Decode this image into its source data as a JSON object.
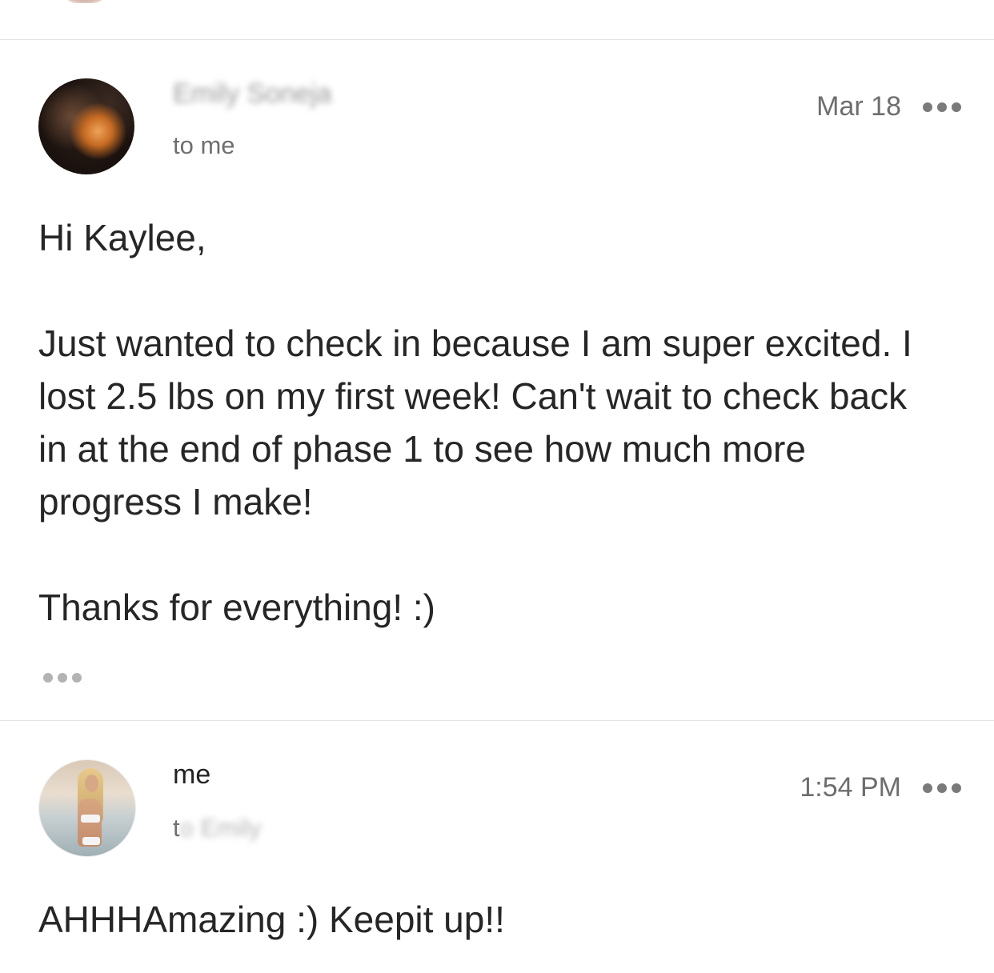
{
  "messages": [
    {
      "sender": "Emily Soneja",
      "recipient": "to me",
      "date": "Mar 18",
      "avatar_icon": "avatar-photo-icon",
      "body": {
        "greeting": "Hi Kaylee,",
        "paragraph": "Just wanted to check in because I am super excited. I lost 2.5 lbs on my first week! Can't wait to check back in at the end of phase 1 to see how much more progress I make!",
        "closing": "Thanks for everything! :)"
      },
      "more_icon": "more-options-icon",
      "quoted_icon": "show-trimmed-content-icon"
    },
    {
      "sender": "me",
      "recipient_first": "t",
      "recipient_rest": "o Emily",
      "date": "1:54 PM",
      "avatar_icon": "avatar-photo-icon",
      "body": {
        "text": "AHHHAmazing :) Keepit up!!"
      },
      "more_icon": "more-options-icon"
    }
  ],
  "colors": {
    "divider": "#e3e3e3",
    "meta_text": "#6e6e6e",
    "body_text": "#262626"
  }
}
